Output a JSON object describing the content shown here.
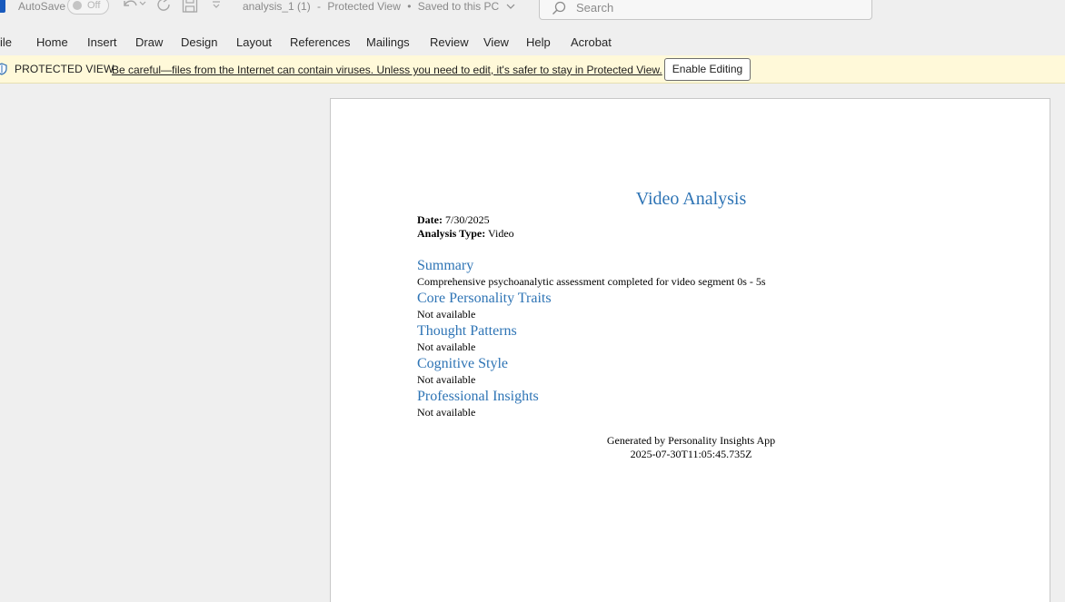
{
  "titlebar": {
    "autosave_label": "AutoSave",
    "autosave_state": "Off",
    "doc_name": "analysis_1 (1)",
    "sep": "-",
    "doc_view": "Protected View",
    "doc_dot": "•",
    "doc_saved": "Saved to this PC",
    "search_placeholder": "Search"
  },
  "ribbon": {
    "tabs": [
      "ile",
      "Home",
      "Insert",
      "Draw",
      "Design",
      "Layout",
      "References",
      "Mailings",
      "Review",
      "View",
      "Help",
      "Acrobat"
    ]
  },
  "protected_view": {
    "label": "PROTECTED VIEW",
    "message": "Be careful—files from the Internet can contain viruses. Unless you need to edit, it's safer to stay in Protected View.",
    "button": "Enable Editing"
  },
  "document": {
    "title": "Video Analysis",
    "date_label": "Date:",
    "date_value": "7/30/2025",
    "type_label": "Analysis Type:",
    "type_value": "Video",
    "sections": [
      {
        "heading": "Summary",
        "body": "Comprehensive psychoanalytic assessment completed for video segment 0s - 5s"
      },
      {
        "heading": "Core Personality Traits",
        "body": "Not available"
      },
      {
        "heading": "Thought Patterns",
        "body": "Not available"
      },
      {
        "heading": "Cognitive Style",
        "body": "Not available"
      },
      {
        "heading": "Professional Insights",
        "body": "Not available"
      }
    ],
    "footer_line1": "Generated by Personality Insights App",
    "footer_line2": "2025-07-30T11:05:45.735Z"
  },
  "colors": {
    "heading": "#2e74b5",
    "protected_bar": "#fff9d9",
    "word_brand": "#185abd"
  },
  "icons": [
    "word-app-icon",
    "undo-icon",
    "redo-icon",
    "save-icon",
    "customize-qat-icon",
    "search-icon",
    "shield-icon",
    "chevron-down-icon"
  ]
}
